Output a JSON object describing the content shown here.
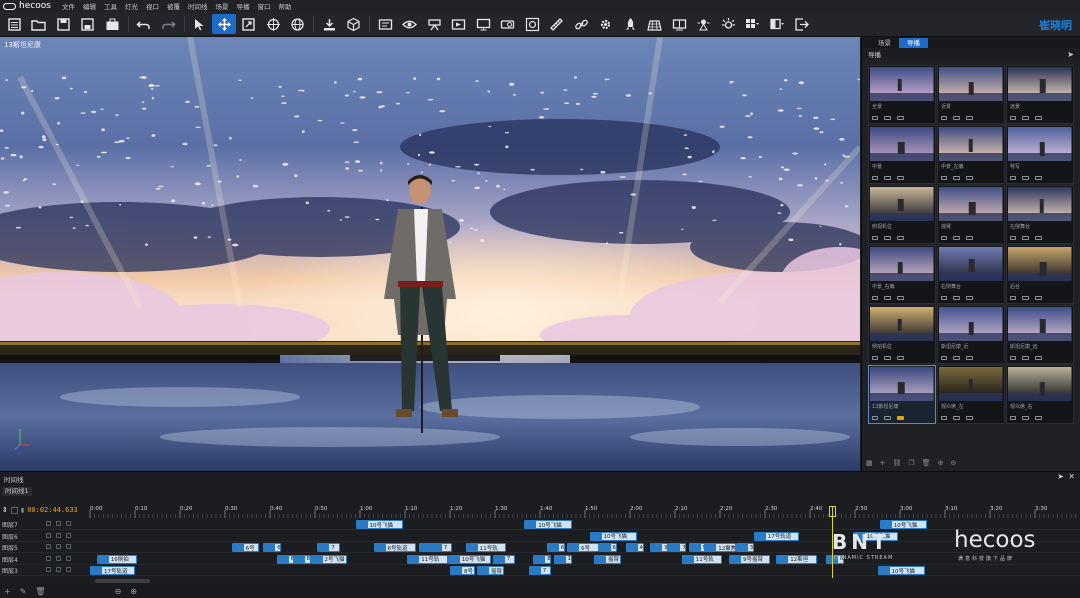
{
  "app": {
    "logo_text": "hecoos",
    "menus": [
      "文件",
      "编辑",
      "工具",
      "灯光",
      "视口",
      "被覆",
      "时间线",
      "场景",
      "导播",
      "窗口",
      "帮助"
    ],
    "user_name": "崔晓明"
  },
  "toolbar": {
    "icons": [
      "menu-icon",
      "open-folder-icon",
      "save-icon",
      "save-as-icon",
      "briefcase-icon",
      "undo-icon",
      "redo-icon",
      "select-arrow-icon",
      "move-icon",
      "scale-icon",
      "rotate-icon",
      "world-icon",
      "import-icon",
      "cube-icon",
      "edit-panel-icon",
      "eye-icon",
      "camera-mount-icon",
      "film-icon",
      "monitor-icon",
      "projector-icon",
      "target-icon",
      "ruler-icon",
      "link-icon",
      "gear-icon",
      "rocket-icon",
      "stage-grid-icon",
      "vr-icon",
      "lights-icon",
      "sun-burst-icon",
      "grid-dropdown-icon",
      "split-view-icon",
      "exit-icon"
    ]
  },
  "viewport": {
    "scene_label": "13斯坦尼康"
  },
  "right_panel": {
    "tabs": [
      "场景",
      "导播"
    ],
    "active_tab": "导播",
    "header": "导播",
    "cameras": [
      {
        "label": "全景"
      },
      {
        "label": "近景"
      },
      {
        "label": "远景"
      },
      {
        "label": "中景"
      },
      {
        "label": "中景_左偏"
      },
      {
        "label": "特写"
      },
      {
        "label": "俯视机位"
      },
      {
        "label": "摇臂"
      },
      {
        "label": "左侧舞台"
      },
      {
        "label": "中景_右偏"
      },
      {
        "label": "右侧舞台"
      },
      {
        "label": "后台"
      },
      {
        "label": "侧拍机位"
      },
      {
        "label": "斯坦尼康_近"
      },
      {
        "label": "斯坦尼康_远"
      },
      {
        "label": "13斯坦尼康"
      },
      {
        "label": "观众席_左"
      },
      {
        "label": "观众席_右"
      }
    ],
    "selected_index": 15
  },
  "timeline": {
    "title": "时间线",
    "tab": "时间线1",
    "current_time": "00:02:44.633",
    "ruler_labels": [
      "0:00",
      "0:10",
      "0:20",
      "0:30",
      "0:40",
      "0:50",
      "1:00",
      "1:10",
      "1:20",
      "1:30",
      "1:40",
      "1:50",
      "2:00",
      "2:10",
      "2:20",
      "2:30",
      "2:40",
      "2:50",
      "3:00",
      "3:10",
      "3:20",
      "3:30"
    ],
    "tracks": [
      {
        "name": "图层7",
        "clips": [
          {
            "label": "10号飞猫",
            "start": 59.0,
            "len": 10.5
          },
          {
            "label": "10号飞猫",
            "start": 96.5,
            "len": 10.5
          },
          {
            "label": "10号飞猫",
            "start": 175.5,
            "len": 10.5
          }
        ]
      },
      {
        "name": "图层6",
        "clips": [
          {
            "label": "10号飞猫",
            "start": 111.0,
            "len": 10.5
          },
          {
            "label": "17号轨道",
            "start": 147.5,
            "len": 10
          },
          {
            "label": "10号飞猫",
            "start": 169.5,
            "len": 10
          }
        ]
      },
      {
        "name": "图层5",
        "clips": [
          {
            "label": "6号",
            "start": 31.5,
            "len": 6
          },
          {
            "label": "6",
            "start": 38.5,
            "len": 4
          },
          {
            "label": "7",
            "start": 50.5,
            "len": 5
          },
          {
            "label": "6号轨道",
            "start": 63.0,
            "len": 9.5
          },
          {
            "label": "1",
            "start": 73.0,
            "len": 3
          },
          {
            "label": "7",
            "start": 75.5,
            "len": 5
          },
          {
            "label": "11号轨",
            "start": 83.5,
            "len": 9
          },
          {
            "label": "6",
            "start": 101.5,
            "len": 4
          },
          {
            "label": "6号",
            "start": 106.0,
            "len": 7
          },
          {
            "label": "6",
            "start": 113.0,
            "len": 4
          },
          {
            "label": "4",
            "start": 119.0,
            "len": 4
          },
          {
            "label": "9",
            "start": 124.5,
            "len": 4
          },
          {
            "label": "7",
            "start": 128.5,
            "len": 4
          },
          {
            "label": "5",
            "start": 133.0,
            "len": 4
          },
          {
            "label": "12聚焦",
            "start": 136.5,
            "len": 7
          },
          {
            "label": "3",
            "start": 143.5,
            "len": 4
          }
        ]
      },
      {
        "name": "图层4",
        "clips": [
          {
            "label": "16侧拍",
            "start": 1.5,
            "len": 9
          },
          {
            "label": "6",
            "start": 41.5,
            "len": 4
          },
          {
            "label": "8",
            "start": 45.0,
            "len": 4
          },
          {
            "label": "2号飞猫",
            "start": 49.0,
            "len": 8
          },
          {
            "label": "11号轨",
            "start": 70.5,
            "len": 9
          },
          {
            "label": "10号飞猫",
            "start": 79.5,
            "len": 9.5
          },
          {
            "label": "7",
            "start": 89.5,
            "len": 5
          },
          {
            "label": "8",
            "start": 98.5,
            "len": 4
          },
          {
            "label": "1",
            "start": 103.0,
            "len": 4
          },
          {
            "label": "摇臂",
            "start": 112.0,
            "len": 6
          },
          {
            "label": "11号轨",
            "start": 131.5,
            "len": 9
          },
          {
            "label": "9号摇臂",
            "start": 142.0,
            "len": 9
          },
          {
            "label": "12斯坦",
            "start": 152.5,
            "len": 9
          },
          {
            "label": "6",
            "start": 163.5,
            "len": 4
          }
        ]
      },
      {
        "name": "图层3",
        "clips": [
          {
            "label": "17号轨道",
            "start": 0.0,
            "len": 10
          },
          {
            "label": "8号",
            "start": 80.0,
            "len": 5.5
          },
          {
            "label": "摇臂",
            "start": 86.0,
            "len": 6
          },
          {
            "label": "7",
            "start": 97.5,
            "len": 5
          },
          {
            "label": "10号飞猫",
            "start": 175.0,
            "len": 10.5
          }
        ]
      }
    ],
    "footer_icons": [
      "add-layer-icon",
      "edit-layer-icon",
      "delete-icon",
      "zoom-out-icon",
      "zoom-in-icon"
    ]
  },
  "watermark": {
    "brand1": "BNT",
    "brand1_sub": "DYNAMIC STREAM",
    "brand2": "hecoos",
    "brand2_sub": "满意科技旗下品牌"
  },
  "colors": {
    "accent": "#1e6ac8",
    "time": "#e4a21b",
    "playhead": "#d6d62c",
    "clip": "#cfe3f4"
  }
}
